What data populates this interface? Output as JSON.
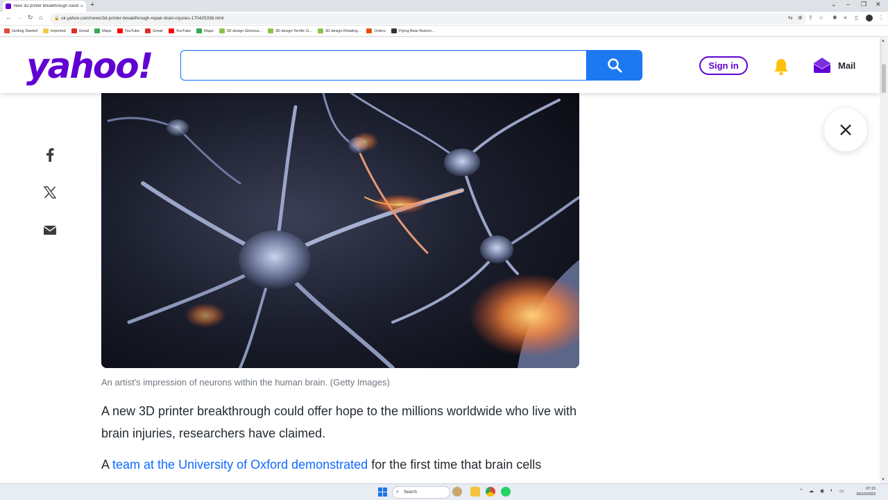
{
  "browser": {
    "tab_title": "New 3D printer breakthrough could...",
    "tab_close": "×",
    "new_tab": "+",
    "url": "uk.yahoo.com/news/3d-printer-breakthrough-repair-brain-injuries-170425336.html",
    "bookmarks": [
      {
        "label": "Getting Started",
        "color": "#e04a3a"
      },
      {
        "label": "Imported",
        "color": "#f2c94c"
      },
      {
        "label": "Gmail",
        "color": "#d93025"
      },
      {
        "label": "Maps",
        "color": "#34a853"
      },
      {
        "label": "YouTube",
        "color": "#ff0000"
      },
      {
        "label": "Gmail",
        "color": "#d93025"
      },
      {
        "label": "YouTube",
        "color": "#ff0000"
      },
      {
        "label": "Maps",
        "color": "#34a853"
      },
      {
        "label": "3D design Glorious...",
        "color": "#8bc34a"
      },
      {
        "label": "3D design Terrific G...",
        "color": "#8bc34a"
      },
      {
        "label": "3D design Rotating...",
        "color": "#8bc34a"
      },
      {
        "label": "Orders",
        "color": "#e65100"
      },
      {
        "label": "Flying Bear Reborn...",
        "color": "#333333"
      }
    ]
  },
  "header": {
    "logo": "yahoo!",
    "search_placeholder": "",
    "signin_label": "Sign in",
    "mail_label": "Mail",
    "brand_color": "#6001d2",
    "search_button_color": "#1d79f2"
  },
  "article": {
    "caption": "An artist's impression of neurons within the human brain. (Getty Images)",
    "para1": "A new 3D printer breakthrough could offer hope to the millions worldwide who live with brain injuries, researchers have claimed.",
    "para2_prefix": "A ",
    "para2_link": "team at the University of Oxford demonstrated",
    "para2_suffix": " for the first time that brain cells"
  },
  "share": {
    "icons": [
      "facebook-icon",
      "x-icon",
      "email-icon"
    ]
  },
  "taskbar": {
    "search_label": "Search",
    "time": "07:15",
    "date": "06/10/2023"
  }
}
